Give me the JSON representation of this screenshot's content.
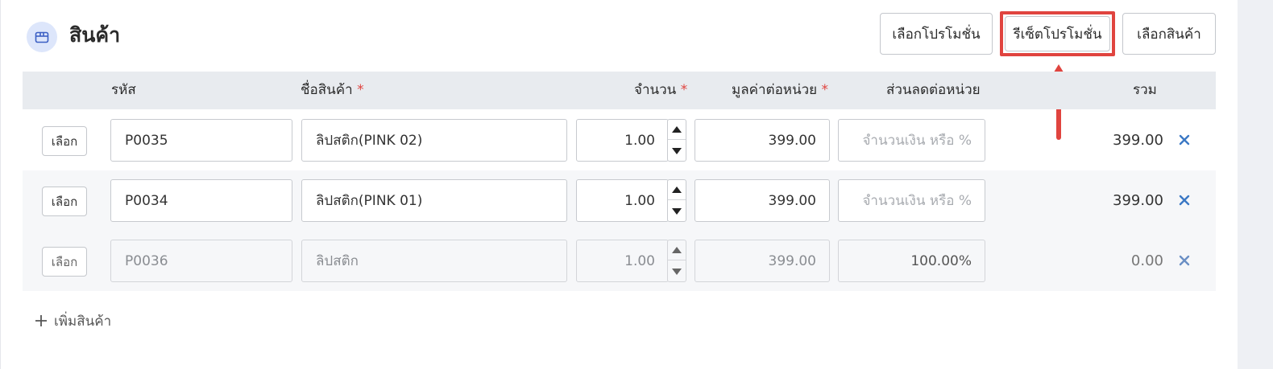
{
  "section": {
    "title": "สินค้า",
    "icon": "box-icon"
  },
  "actions": {
    "select_promotion": "เลือกโปรโมชั่น",
    "reset_promotion": "รีเซ็ตโปรโมชั่น",
    "select_product": "เลือกสินค้า"
  },
  "columns": {
    "code": "รหัส",
    "name": "ชื่อสินค้า",
    "quantity": "จำนวน",
    "unit_price": "มูลค่าต่อหน่วย",
    "discount": "ส่วนลดต่อหน่วย",
    "total": "รวม",
    "required_mark": "*"
  },
  "rows": [
    {
      "select_label": "เลือก",
      "code": "P0035",
      "name": "ลิปสติก(PINK 02)",
      "quantity": "1.00",
      "unit_price": "399.00",
      "discount_placeholder": "จำนวนเงิน หรือ %",
      "discount": "",
      "total": "399.00"
    },
    {
      "select_label": "เลือก",
      "code": "P0034",
      "name": "ลิปสติก(PINK 01)",
      "quantity": "1.00",
      "unit_price": "399.00",
      "discount_placeholder": "จำนวนเงิน หรือ %",
      "discount": "",
      "total": "399.00"
    },
    {
      "select_label": "เลือก",
      "code": "P0036",
      "name": "ลิปสติก",
      "quantity": "1.00",
      "unit_price": "399.00",
      "discount_placeholder": "",
      "discount": "100.00%",
      "total": "0.00"
    }
  ],
  "add_product": {
    "label": "เพิ่มสินค้า"
  },
  "colors": {
    "highlight": "#e0443f",
    "delete": "#3b78c4",
    "header_bg": "#e8ebef"
  }
}
